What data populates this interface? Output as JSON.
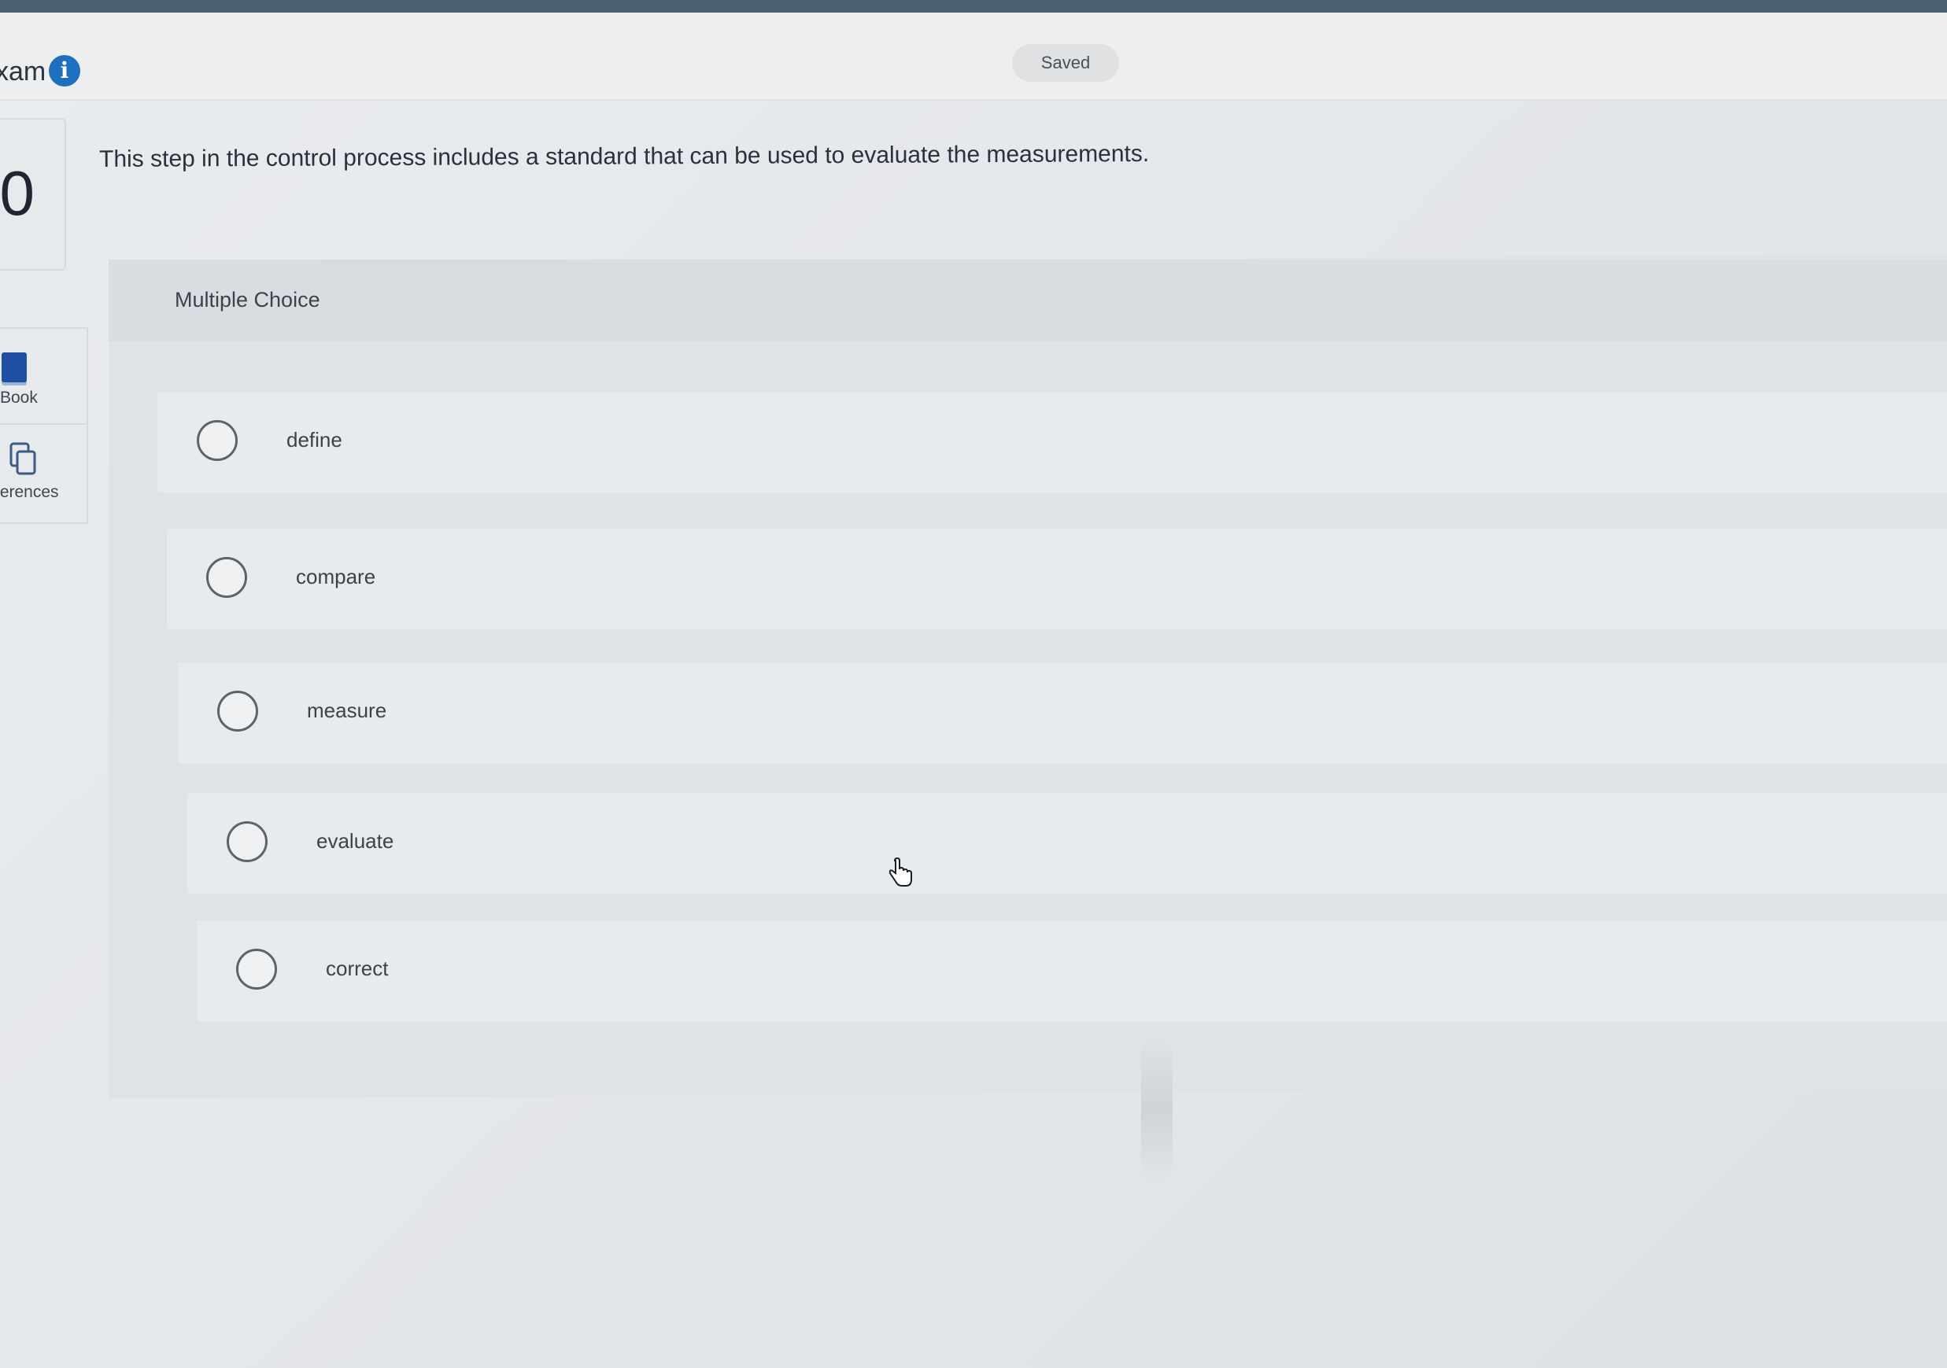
{
  "header": {
    "exam_title": "xam",
    "saved_label": "Saved"
  },
  "question": {
    "number": "0",
    "text": "This step in the control process includes a standard that can be used to evaluate the measurements."
  },
  "side_tools": [
    {
      "label": "Book",
      "icon": "book-icon"
    },
    {
      "label": "ferences",
      "icon": "references-icon"
    }
  ],
  "answer": {
    "type_label": "Multiple Choice",
    "choices": [
      {
        "label": "define"
      },
      {
        "label": "compare"
      },
      {
        "label": "measure"
      },
      {
        "label": "evaluate"
      },
      {
        "label": "correct"
      }
    ]
  },
  "colors": {
    "top_bar": "#4d5f72",
    "info_icon": "#1e6fbf",
    "book_icon": "#1e4fa3"
  }
}
